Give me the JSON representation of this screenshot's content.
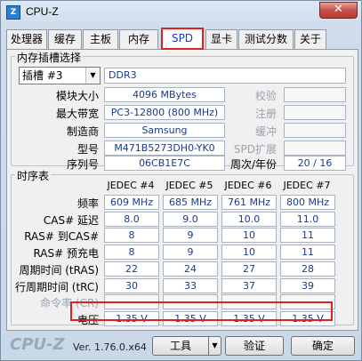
{
  "window": {
    "title": "CPU-Z",
    "icon_text": "Z",
    "close_label": "✕"
  },
  "tabs": [
    {
      "label": "处理器"
    },
    {
      "label": "缓存"
    },
    {
      "label": "主板"
    },
    {
      "label": "内存"
    },
    {
      "label": "SPD"
    },
    {
      "label": "显卡"
    },
    {
      "label": "测试分数"
    },
    {
      "label": "关于"
    }
  ],
  "active_tab": "SPD",
  "slot_group": {
    "title": "内存插槽选择",
    "slot_value": "插槽 #3",
    "memory_type": "DDR3",
    "rows": [
      {
        "label": "模块大小",
        "value": "4096 MBytes",
        "side_label": "校验",
        "side_value": ""
      },
      {
        "label": "最大带宽",
        "value": "PC3-12800 (800 MHz)",
        "side_label": "注册",
        "side_value": ""
      },
      {
        "label": "制造商",
        "value": "Samsung",
        "side_label": "缓冲",
        "side_value": ""
      },
      {
        "label": "型号",
        "value": "M471B5273DH0-YK0",
        "side_label": "SPD扩展",
        "side_value": ""
      },
      {
        "label": "序列号",
        "value": "06CB1E7C",
        "side_label": "周次/年份",
        "side_value": "20 / 16"
      }
    ]
  },
  "timing_group": {
    "title": "时序表",
    "columns": [
      "JEDEC #4",
      "JEDEC #5",
      "JEDEC #6",
      "JEDEC #7"
    ],
    "rows": [
      {
        "label": "频率",
        "values": [
          "609 MHz",
          "685 MHz",
          "761 MHz",
          "800 MHz"
        ]
      },
      {
        "label": "CAS# 延迟",
        "values": [
          "8.0",
          "9.0",
          "10.0",
          "11.0"
        ]
      },
      {
        "label": "RAS# 到CAS#",
        "values": [
          "8",
          "9",
          "10",
          "11"
        ]
      },
      {
        "label": "RAS# 预充电",
        "values": [
          "8",
          "9",
          "10",
          "11"
        ]
      },
      {
        "label": "周期时间 (tRAS)",
        "values": [
          "22",
          "24",
          "27",
          "28"
        ]
      },
      {
        "label": "行周期时间 (tRC)",
        "values": [
          "30",
          "33",
          "37",
          "39"
        ]
      },
      {
        "label": "命令率 (CR)",
        "values": [
          "",
          "",
          "",
          ""
        ]
      },
      {
        "label": "电压",
        "values": [
          "1.35 V",
          "1.35 V",
          "1.35 V",
          "1.35 V"
        ]
      }
    ]
  },
  "footer": {
    "brand": "CPU-Z",
    "version": "Ver. 1.76.0.x64",
    "tools_label": "工具",
    "validate_label": "验证",
    "ok_label": "确定"
  },
  "colors": {
    "highlight": "#e02020",
    "value_text": "#1b3a8a"
  }
}
